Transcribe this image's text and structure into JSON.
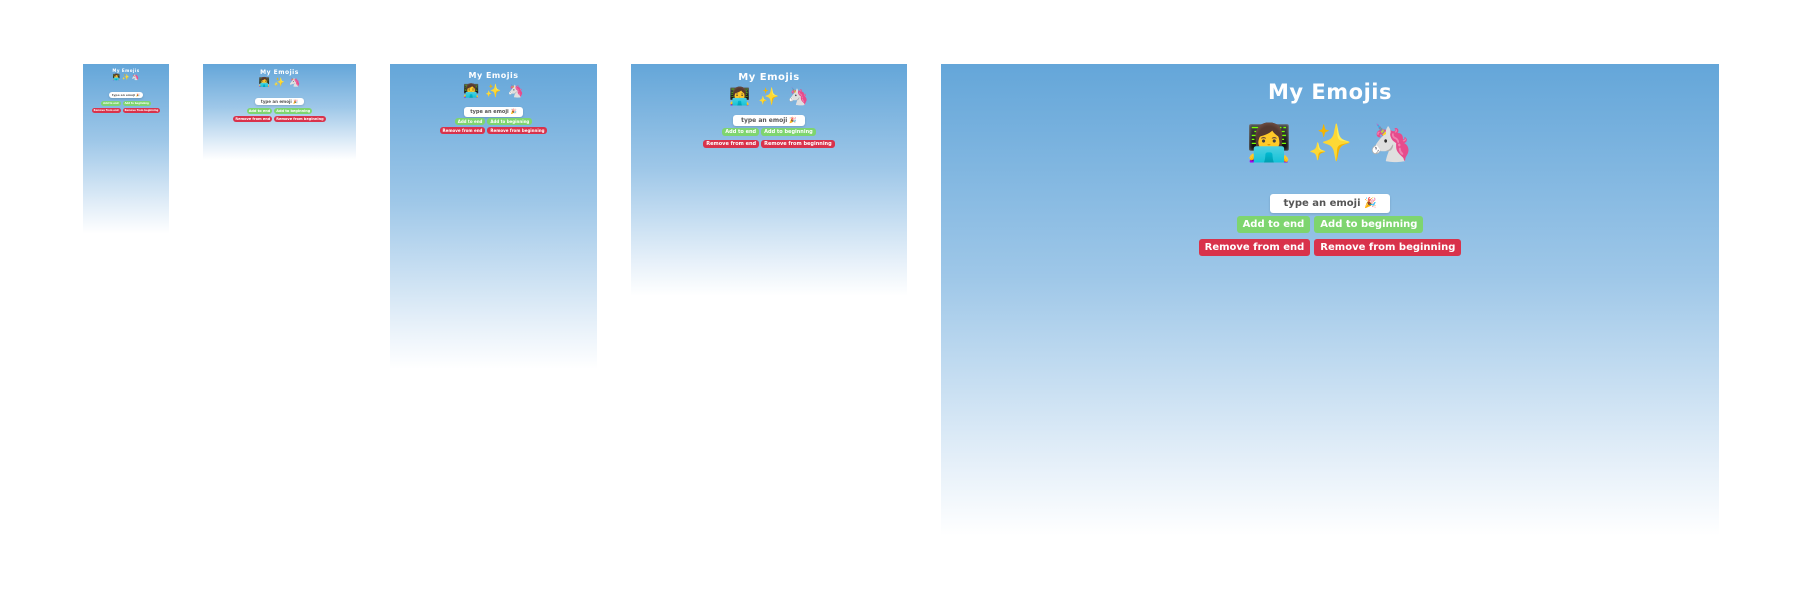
{
  "app": {
    "title": "My Emojis",
    "emojis": [
      "👩‍💻",
      "✨",
      "🦄"
    ],
    "input_placeholder": "type an emoji 🎉",
    "buttons": {
      "add_end": "Add to end",
      "add_beginning": "Add to beginning",
      "remove_end": "Remove from end",
      "remove_beginning": "Remove from beginning"
    }
  },
  "colors": {
    "gradient_top": "#64a6d9",
    "green_button": "#7ed56f",
    "red_button": "#d9324b"
  }
}
